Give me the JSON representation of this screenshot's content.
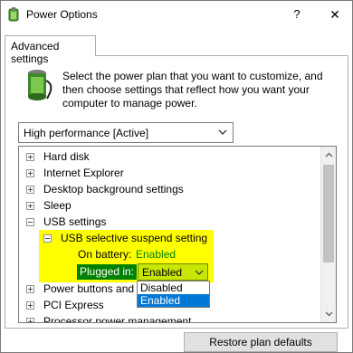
{
  "window": {
    "title": "Power Options",
    "help_label": "?",
    "close_label": "✕"
  },
  "tab": {
    "label": "Advanced settings"
  },
  "description": "Select the power plan that you want to customize, and then choose settings that reflect how you want your computer to manage power.",
  "plan_select": {
    "value": "High performance [Active]"
  },
  "tree": {
    "items": [
      {
        "label": "Hard disk"
      },
      {
        "label": "Internet Explorer"
      },
      {
        "label": "Desktop background settings"
      },
      {
        "label": "Sleep"
      },
      {
        "label": "USB settings"
      },
      {
        "label": "USB selective suspend setting"
      },
      {
        "label": "On battery:",
        "value": "Enabled"
      },
      {
        "label": "Plugged in:",
        "value": "Enabled"
      },
      {
        "label": "Power buttons and"
      },
      {
        "label": "PCI Express"
      },
      {
        "label": "Processor power management"
      }
    ]
  },
  "dropdown": {
    "options": [
      "Disabled",
      "Enabled"
    ],
    "selected": "Enabled"
  },
  "buttons": {
    "restore": "Restore plan defaults"
  },
  "colors": {
    "highlight": "#ffff00",
    "green": "#008000",
    "selection": "#0078d7"
  }
}
